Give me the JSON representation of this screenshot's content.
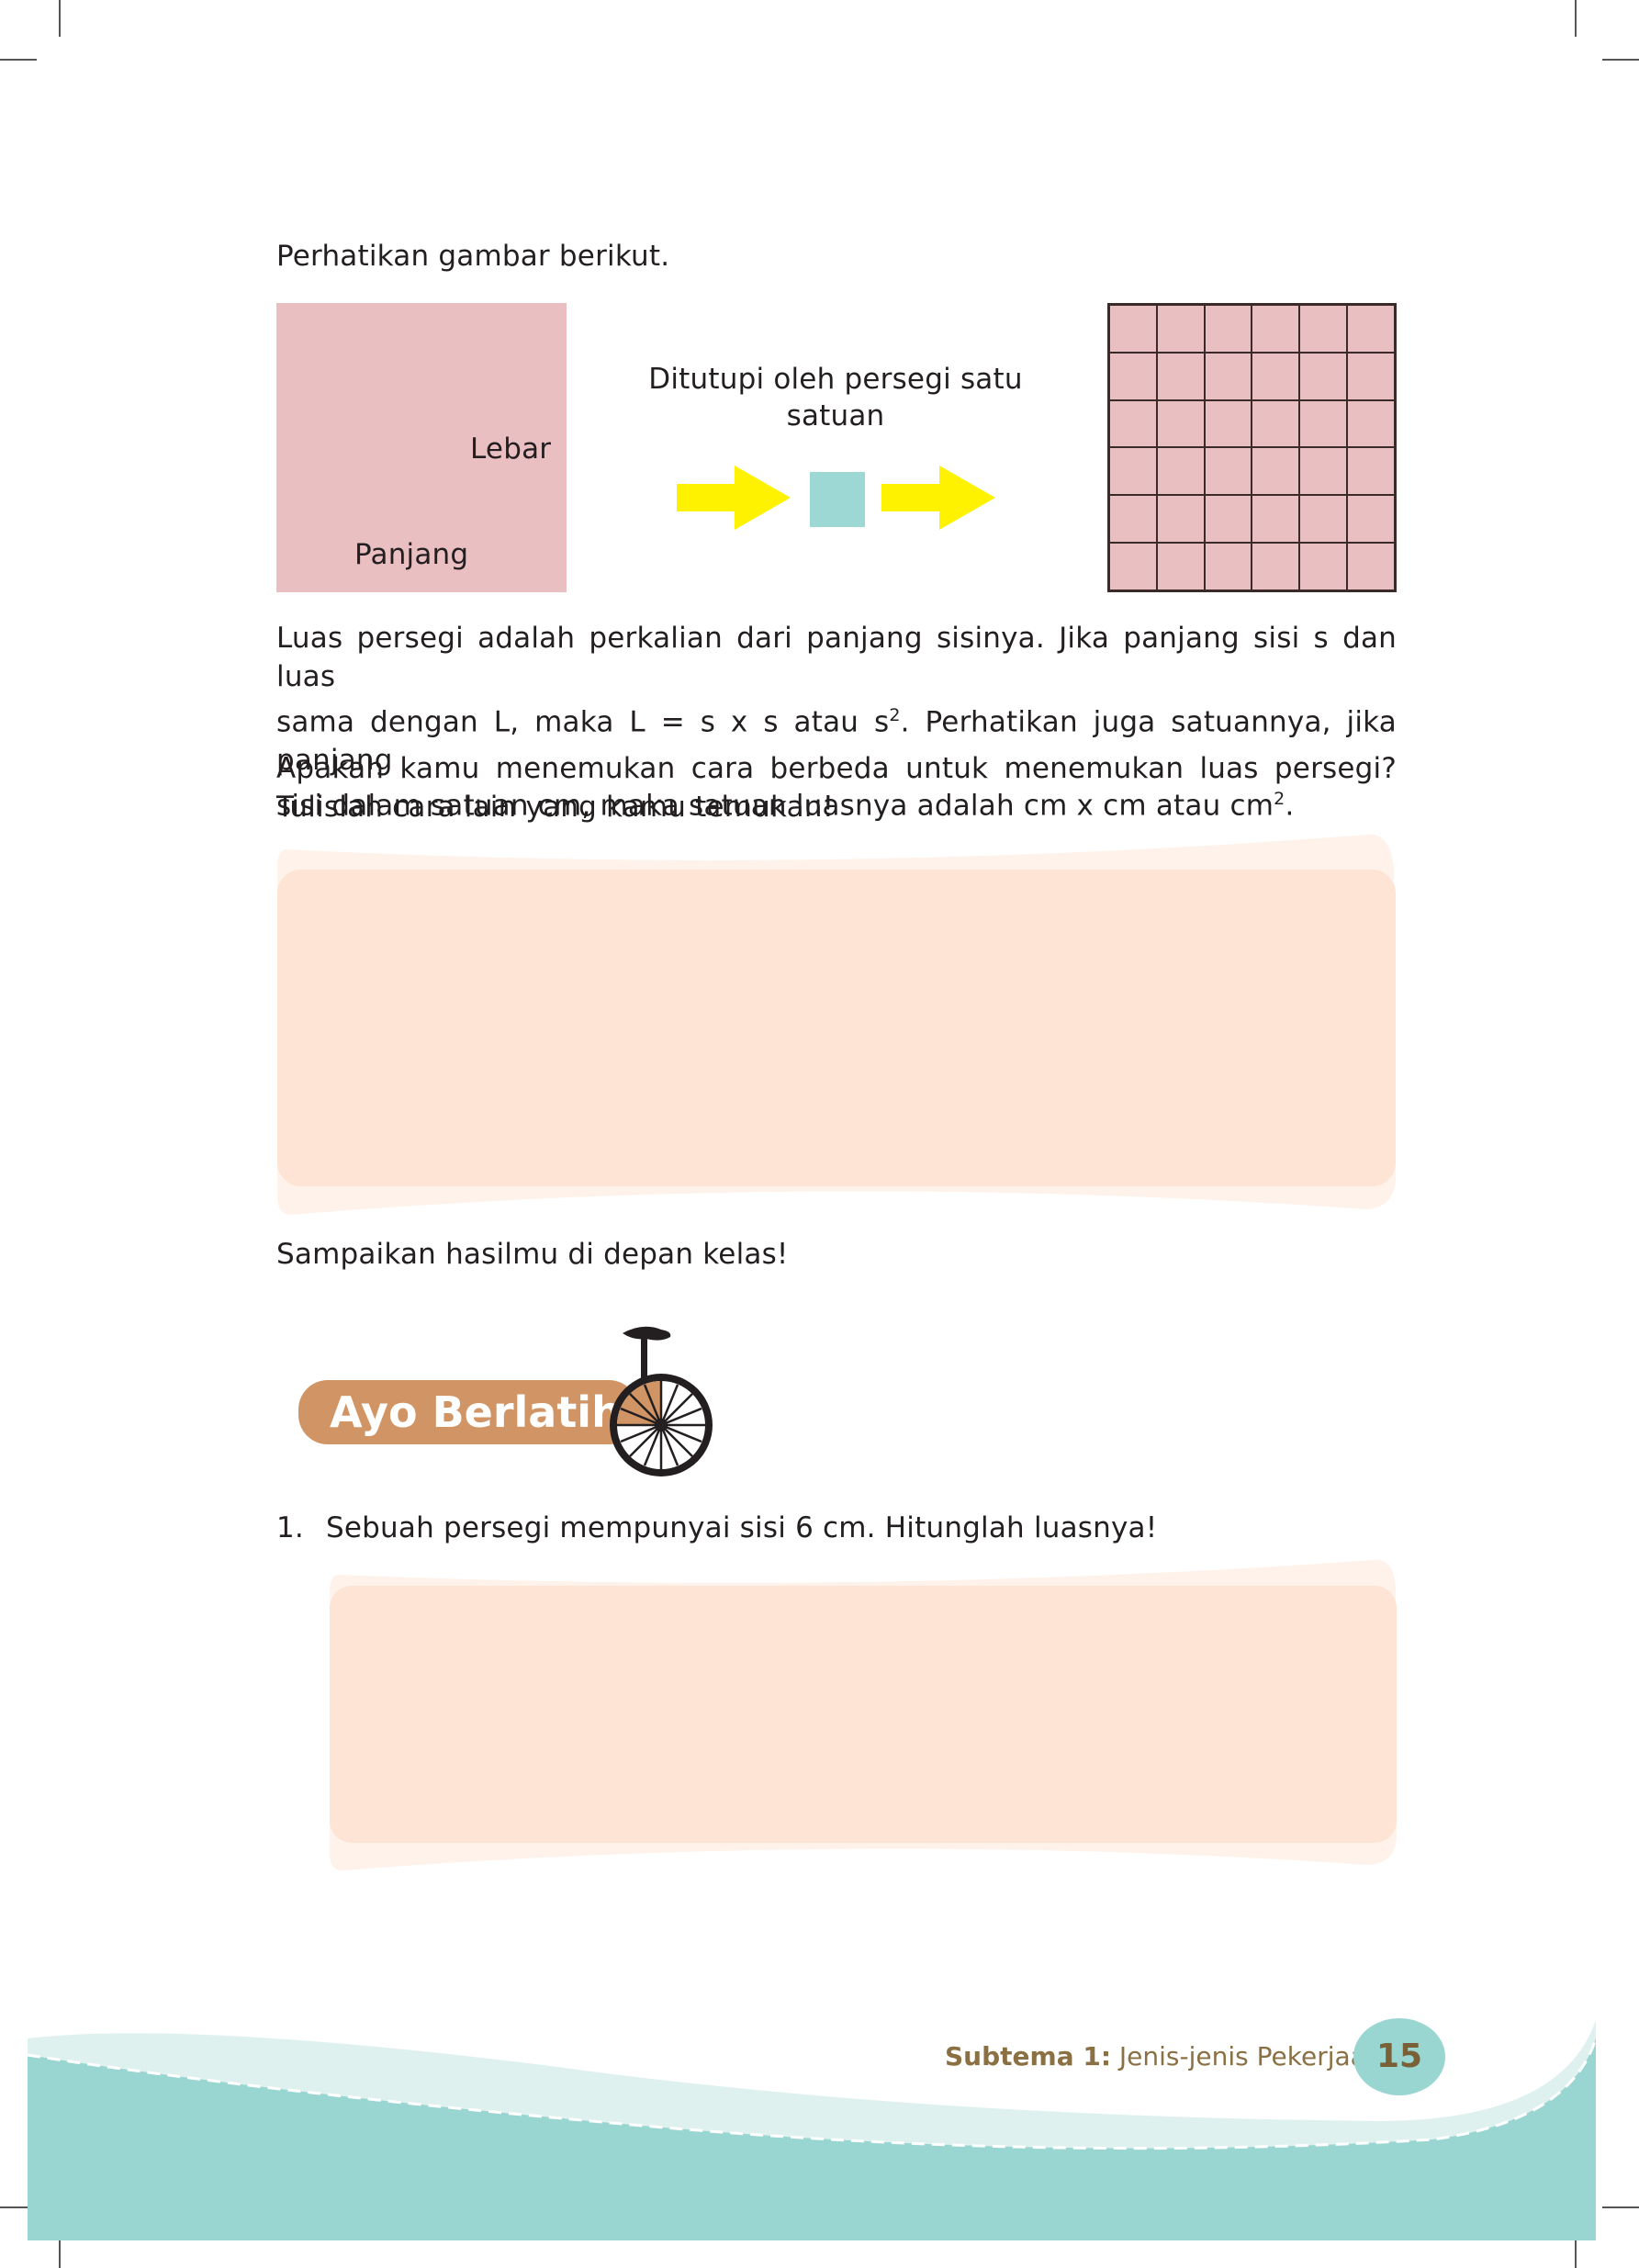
{
  "intro": "Perhatikan gambar berikut.",
  "figure": {
    "lebar_label": "Lebar",
    "panjang_label": "Panjang",
    "caption_line1": "Ditutupi oleh persegi satu",
    "caption_line2": "satuan",
    "grid_rows": 6,
    "grid_cols": 6,
    "colors": {
      "square": "#eabfc2",
      "arrow": "#fff200",
      "unit_square": "#9dd8d4",
      "grid_line": "#3a2a2a"
    }
  },
  "paragraph1": {
    "line1": "Luas persegi adalah perkalian dari panjang sisinya. Jika panjang sisi s dan luas",
    "line2a": "sama dengan L, maka L = s x s atau s",
    "line2sup": "2",
    "line2b": ". Perhatikan juga satuannya, jika panjang",
    "line3a": "sisi dalam satuan cm, maka satuan luasnya adalah cm x cm atau cm",
    "line3sup": "2",
    "line3b": "."
  },
  "paragraph2": {
    "line1": "Apakah kamu menemukan cara berbeda untuk menemukan luas persegi?",
    "line2": "Tulislah cara lain yang kamu temukan!"
  },
  "closing": "Sampaikan hasilmu di depan kelas!",
  "section_banner": "Ayo Berlatih",
  "exercise": {
    "number": "1.",
    "text": "Sebuah persegi mempunyai sisi 6 cm. Hitunglah luasnya!"
  },
  "footer": {
    "subtema_label": "Subtema 1:",
    "subtema_title": "Jenis-jenis Pekerjaan",
    "page_number": "15"
  },
  "colors": {
    "answer_box": "#fde4d4",
    "answer_box_shadow": "#fef2ea",
    "banner": "#d19464",
    "footer_wave": "#99d6d2",
    "footer_text": "#8a7043"
  }
}
